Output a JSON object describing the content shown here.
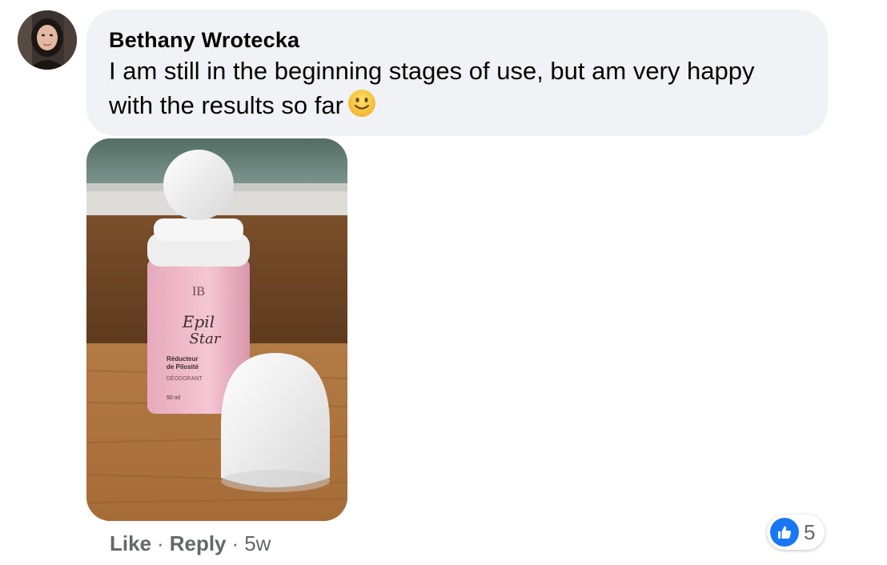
{
  "comment": {
    "author": "Bethany Wrotecka",
    "text": "I am still in the beginning stages of use, but am very happy with the results so far",
    "emoji": "slightly-smiling-face-icon",
    "photo": {
      "label_lines": [
        "Epil",
        "Star",
        "Réducteur",
        "de Pilosité",
        "DÉODORANT",
        "50 ml"
      ]
    },
    "actions": {
      "like": "Like",
      "separator": "·",
      "reply": "Reply",
      "time": "5w"
    },
    "reactions": {
      "icon": "thumbs-up-icon",
      "count": "5"
    }
  },
  "colors": {
    "bubble": "#f0f2f5",
    "meta_text": "#65676b",
    "like_blue": "#1877f2"
  }
}
